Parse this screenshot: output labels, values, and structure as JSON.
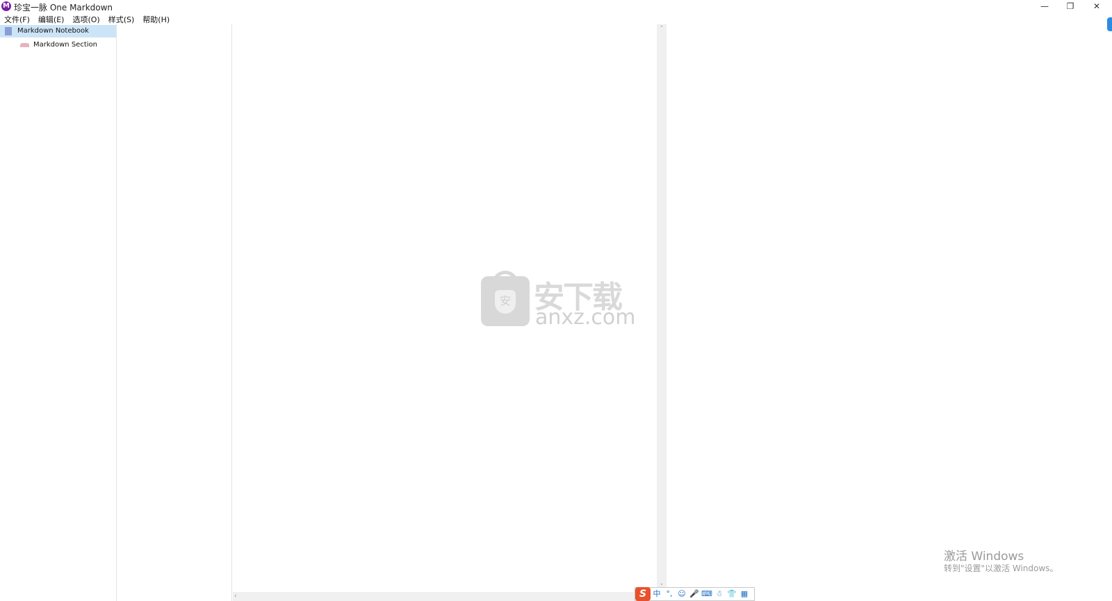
{
  "window": {
    "app_icon_letter": "M",
    "title": "珍宝一脉 One Markdown",
    "min_glyph": "—",
    "max_glyph": "❐",
    "close_glyph": "✕"
  },
  "menu": {
    "items": [
      {
        "label": "文件(F)"
      },
      {
        "label": "编辑(E)"
      },
      {
        "label": "选项(O)"
      },
      {
        "label": "样式(S)"
      },
      {
        "label": "帮助(H)"
      }
    ]
  },
  "tree": {
    "notebook_label": "Markdown Notebook",
    "section_label": "Markdown Section"
  },
  "scroll": {
    "up": "˄",
    "down": "˅",
    "left": "‹"
  },
  "watermark": {
    "shield_char": "安",
    "cn_text": "安下载",
    "en_text": "anxz.com"
  },
  "activation": {
    "title": "激活 Windows",
    "subtitle": "转到\"设置\"以激活 Windows。"
  },
  "ime": {
    "logo": "S",
    "buttons": [
      "中",
      "°,",
      "☺",
      "🎤",
      "⌨",
      "☃",
      "👕",
      "▦"
    ]
  },
  "colors": {
    "selection": "#cce4f7",
    "notebook_icon": "#8a9ed4",
    "section_icon": "#e6b3bf",
    "app_icon": "#7b1fa2",
    "ime_logo": "#e8512c"
  }
}
